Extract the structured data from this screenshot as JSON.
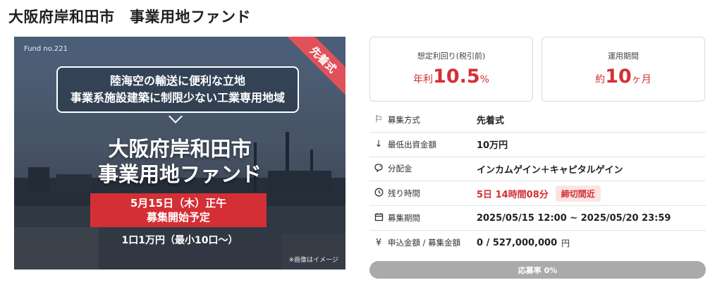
{
  "page": {
    "title": "大阪府岸和田市　事業用地ファンド"
  },
  "hero": {
    "fund_no": "Fund no.221",
    "ribbon": "先着式",
    "bubble_line1": "陸海空の輸送に便利な立地",
    "bubble_line2": "事業系施設建築に制限少ない工業専用地域",
    "title_line1": "大阪府岸和田市",
    "title_line2": "事業用地ファンド",
    "date_line1": "5月15日（木）正午",
    "date_line2": "募集開始予定",
    "unit_text": "1口1万円（最小10口〜）",
    "note": "※画像はイメージ"
  },
  "stats": {
    "yield": {
      "label": "想定利回り(税引前)",
      "prefix": "年利",
      "value": "10.5",
      "suffix": "%"
    },
    "period": {
      "label": "運用期間",
      "prefix": "約",
      "value": "10",
      "suffix": "ヶ月"
    }
  },
  "info": {
    "rows": [
      {
        "icon": "flag-icon",
        "label": "募集方式",
        "value": "先着式"
      },
      {
        "icon": "arrow-down-icon",
        "label": "最低出資金額",
        "value": "10万円"
      },
      {
        "icon": "piggy-bank-icon",
        "label": "分配金",
        "value": "インカムゲイン＋キャピタルゲイン"
      },
      {
        "icon": "clock-icon",
        "label": "残り時間",
        "value": "5日 14時間08分",
        "badge": "締切間近"
      },
      {
        "icon": "calendar-icon",
        "label": "募集期間",
        "value": "2025/05/15 12:00 ~ 2025/05/20 23:59"
      },
      {
        "icon": "yen-icon",
        "label": "申込金額 / 募集金額",
        "value": "0 / 527,000,000",
        "unit": "円"
      }
    ]
  },
  "progress": {
    "label": "応募率 0%",
    "value": 0
  },
  "colors": {
    "accent": "#d42f35",
    "progress_bg": "#aaaaaa",
    "badge_bg": "#fbe4e4"
  }
}
